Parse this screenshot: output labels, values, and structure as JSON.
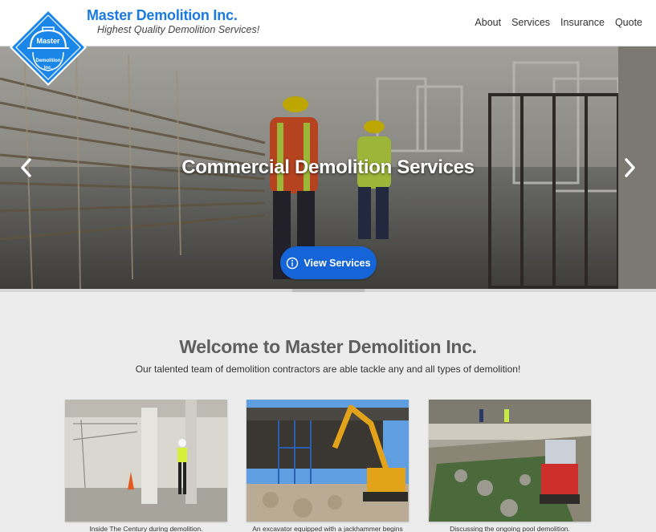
{
  "header": {
    "brand_title": "Master Demolition Inc.",
    "brand_tagline": "Highest Quality Demolition Services!",
    "logo": {
      "text_top": "Master",
      "text_mid": "Demolition",
      "text_bot": "Inc."
    },
    "nav": [
      "About",
      "Services",
      "Insurance",
      "Quote"
    ]
  },
  "hero": {
    "title": "Commercial Demolition Services",
    "cta_label": "View Services",
    "cta_icon": "info-circle-icon",
    "prev_icon": "chevron-left-icon",
    "next_icon": "chevron-right-icon"
  },
  "welcome": {
    "title": "Welcome to Master Demolition Inc.",
    "subtitle": "Our talented team of demolition contractors are able tackle any and all types of demolition!"
  },
  "cards": [
    {
      "caption": "Inside The Century during demolition."
    },
    {
      "caption": "An excavator equipped with a jackhammer begins"
    },
    {
      "caption": "Discussing the ongoing pool demolition."
    }
  ],
  "colors": {
    "brand_blue": "#1a7ae0",
    "cta_blue": "#1565d8",
    "page_bg": "#ececec"
  }
}
